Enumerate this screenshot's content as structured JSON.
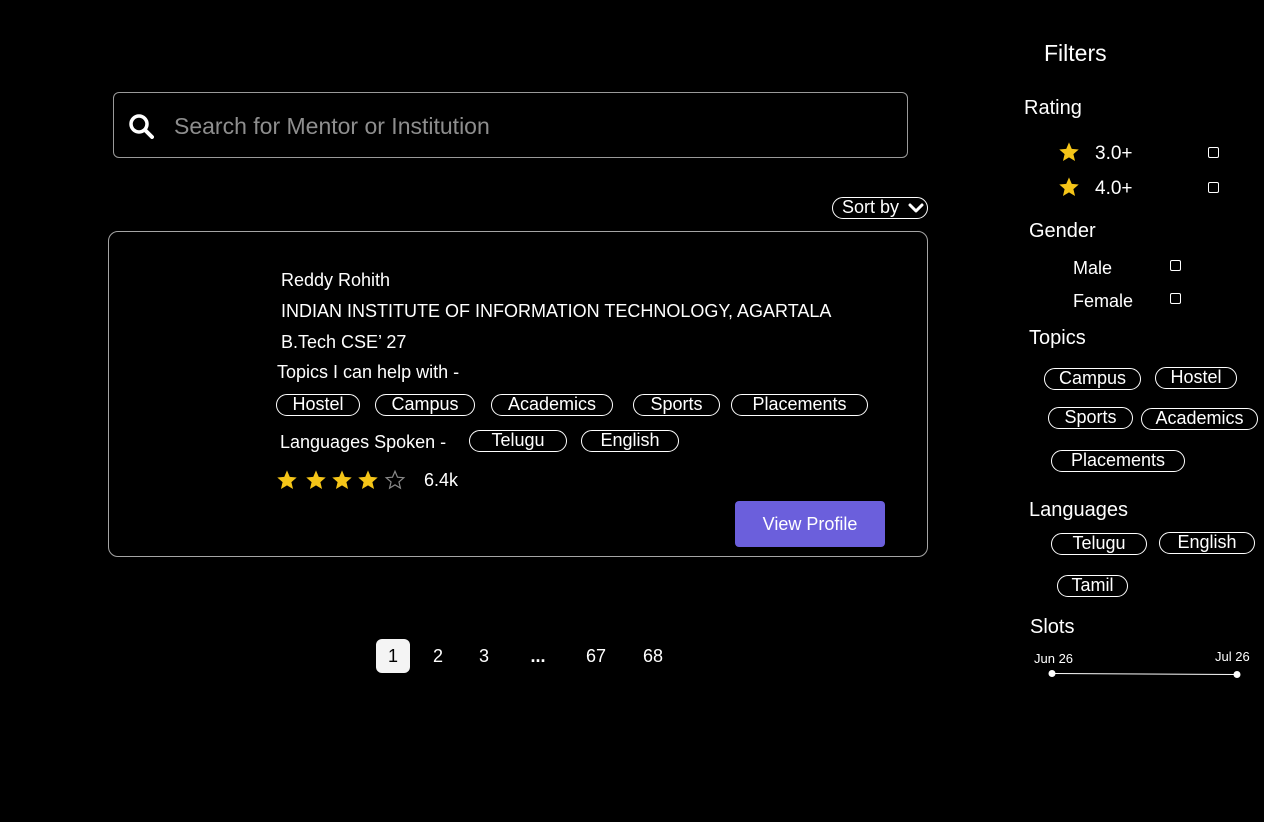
{
  "search": {
    "placeholder": "Search for Mentor or Institution"
  },
  "sort": {
    "label": "Sort by"
  },
  "mentor": {
    "name": "Reddy Rohith",
    "institution": "INDIAN INSTITUTE OF INFORMATION TECHNOLOGY, AGARTALA",
    "degree": "B.Tech CSE’ 27",
    "topics_label": "Topics I can help with -",
    "topics": [
      "Hostel",
      "Campus",
      "Academics",
      "Sports",
      "Placements"
    ],
    "languages_label": "Languages Spoken -",
    "languages": [
      "Telugu",
      "English"
    ],
    "rating_stars": 4,
    "rating_max": 5,
    "reviews": "6.4k",
    "view_profile": "View Profile"
  },
  "pagination": {
    "pages": [
      "1",
      "2",
      "3",
      "...",
      "67",
      "68"
    ],
    "active": "1"
  },
  "filters": {
    "title": "Filters",
    "rating": {
      "label": "Rating",
      "options": [
        "3.0+",
        "4.0+"
      ]
    },
    "gender": {
      "label": "Gender",
      "options": [
        "Male",
        "Female"
      ]
    },
    "topics": {
      "label": "Topics",
      "options": [
        "Campus",
        "Hostel",
        "Sports",
        "Academics",
        "Placements"
      ]
    },
    "languages": {
      "label": "Languages",
      "options": [
        "Telugu",
        "English",
        "Tamil"
      ]
    },
    "slots": {
      "label": "Slots",
      "start": "Jun 26",
      "end": "Jul 26"
    }
  },
  "colors": {
    "accent": "#6b5fdc",
    "star": "#f5c518",
    "background": "#000000"
  }
}
